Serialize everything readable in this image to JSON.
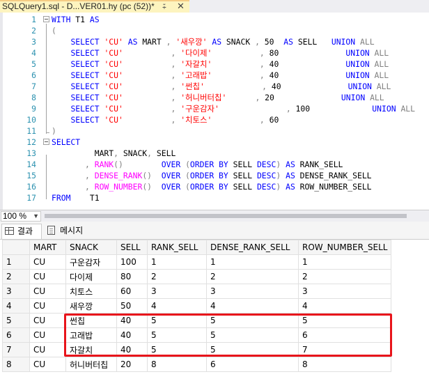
{
  "tab": {
    "title": "SQLQuery1.sql - D...VER01.hy (pc (52))*",
    "pin_icon": "pin-icon",
    "close_icon": "close-icon"
  },
  "editor": {
    "lines": [
      {
        "n": "1",
        "segs": [
          {
            "c": "kw",
            "t": "WITH"
          },
          {
            "c": "",
            "t": " T1 "
          },
          {
            "c": "kw",
            "t": "AS"
          }
        ]
      },
      {
        "n": "2",
        "segs": [
          {
            "c": "gr",
            "t": "("
          }
        ]
      },
      {
        "n": "3",
        "segs": [
          {
            "c": "",
            "t": "    "
          },
          {
            "c": "kw",
            "t": "SELECT"
          },
          {
            "c": "",
            "t": " "
          },
          {
            "c": "str",
            "t": "'CU'"
          },
          {
            "c": "",
            "t": " "
          },
          {
            "c": "kw",
            "t": "AS"
          },
          {
            "c": "",
            "t": " MART "
          },
          {
            "c": "gr",
            "t": ","
          },
          {
            "c": "",
            "t": " "
          },
          {
            "c": "str",
            "t": "'새우깡'"
          },
          {
            "c": "",
            "t": " "
          },
          {
            "c": "kw",
            "t": "AS"
          },
          {
            "c": "",
            "t": " SNACK "
          },
          {
            "c": "gr",
            "t": ","
          },
          {
            "c": "",
            "t": " 50  "
          },
          {
            "c": "kw",
            "t": "AS"
          },
          {
            "c": "",
            "t": " SELL   "
          },
          {
            "c": "kw",
            "t": "UNION"
          },
          {
            "c": "",
            "t": " "
          },
          {
            "c": "gr",
            "t": "ALL"
          }
        ]
      },
      {
        "n": "4",
        "segs": [
          {
            "c": "",
            "t": "    "
          },
          {
            "c": "kw",
            "t": "SELECT"
          },
          {
            "c": "",
            "t": " "
          },
          {
            "c": "str",
            "t": "'CU'"
          },
          {
            "c": "",
            "t": "          "
          },
          {
            "c": "gr",
            "t": ","
          },
          {
            "c": "",
            "t": " "
          },
          {
            "c": "str",
            "t": "'다이제'"
          },
          {
            "c": "",
            "t": "          "
          },
          {
            "c": "gr",
            "t": ","
          },
          {
            "c": "",
            "t": " 80              "
          },
          {
            "c": "kw",
            "t": "UNION"
          },
          {
            "c": "",
            "t": " "
          },
          {
            "c": "gr",
            "t": "ALL"
          }
        ]
      },
      {
        "n": "5",
        "segs": [
          {
            "c": "",
            "t": "    "
          },
          {
            "c": "kw",
            "t": "SELECT"
          },
          {
            "c": "",
            "t": " "
          },
          {
            "c": "str",
            "t": "'CU'"
          },
          {
            "c": "",
            "t": "          "
          },
          {
            "c": "gr",
            "t": ","
          },
          {
            "c": "",
            "t": " "
          },
          {
            "c": "str",
            "t": "'자갈치'"
          },
          {
            "c": "",
            "t": "          "
          },
          {
            "c": "gr",
            "t": ","
          },
          {
            "c": "",
            "t": " 40              "
          },
          {
            "c": "kw",
            "t": "UNION"
          },
          {
            "c": "",
            "t": " "
          },
          {
            "c": "gr",
            "t": "ALL"
          }
        ]
      },
      {
        "n": "6",
        "segs": [
          {
            "c": "",
            "t": "    "
          },
          {
            "c": "kw",
            "t": "SELECT"
          },
          {
            "c": "",
            "t": " "
          },
          {
            "c": "str",
            "t": "'CU'"
          },
          {
            "c": "",
            "t": "          "
          },
          {
            "c": "gr",
            "t": ","
          },
          {
            "c": "",
            "t": " "
          },
          {
            "c": "str",
            "t": "'고래밥'"
          },
          {
            "c": "",
            "t": "          "
          },
          {
            "c": "gr",
            "t": ","
          },
          {
            "c": "",
            "t": " 40              "
          },
          {
            "c": "kw",
            "t": "UNION"
          },
          {
            "c": "",
            "t": " "
          },
          {
            "c": "gr",
            "t": "ALL"
          }
        ]
      },
      {
        "n": "7",
        "segs": [
          {
            "c": "",
            "t": "    "
          },
          {
            "c": "kw",
            "t": "SELECT"
          },
          {
            "c": "",
            "t": " "
          },
          {
            "c": "str",
            "t": "'CU'"
          },
          {
            "c": "",
            "t": "          "
          },
          {
            "c": "gr",
            "t": ","
          },
          {
            "c": "",
            "t": " "
          },
          {
            "c": "str",
            "t": "'썬칩'"
          },
          {
            "c": "",
            "t": "            "
          },
          {
            "c": "gr",
            "t": ","
          },
          {
            "c": "",
            "t": " 40              "
          },
          {
            "c": "kw",
            "t": "UNION"
          },
          {
            "c": "",
            "t": " "
          },
          {
            "c": "gr",
            "t": "ALL"
          }
        ]
      },
      {
        "n": "8",
        "segs": [
          {
            "c": "",
            "t": "    "
          },
          {
            "c": "kw",
            "t": "SELECT"
          },
          {
            "c": "",
            "t": " "
          },
          {
            "c": "str",
            "t": "'CU'"
          },
          {
            "c": "",
            "t": "          "
          },
          {
            "c": "gr",
            "t": ","
          },
          {
            "c": "",
            "t": " "
          },
          {
            "c": "str",
            "t": "'허니버터칩'"
          },
          {
            "c": "",
            "t": "      "
          },
          {
            "c": "gr",
            "t": ","
          },
          {
            "c": "",
            "t": " 20              "
          },
          {
            "c": "kw",
            "t": "UNION"
          },
          {
            "c": "",
            "t": " "
          },
          {
            "c": "gr",
            "t": "ALL"
          }
        ]
      },
      {
        "n": "9",
        "segs": [
          {
            "c": "",
            "t": "    "
          },
          {
            "c": "kw",
            "t": "SELECT"
          },
          {
            "c": "",
            "t": " "
          },
          {
            "c": "str",
            "t": "'CU'"
          },
          {
            "c": "",
            "t": "          "
          },
          {
            "c": "gr",
            "t": ","
          },
          {
            "c": "",
            "t": " "
          },
          {
            "c": "str",
            "t": "'구운감자'"
          },
          {
            "c": "",
            "t": "              "
          },
          {
            "c": "gr",
            "t": ","
          },
          {
            "c": "",
            "t": " 100             "
          },
          {
            "c": "kw",
            "t": "UNION"
          },
          {
            "c": "",
            "t": " "
          },
          {
            "c": "gr",
            "t": "ALL"
          }
        ]
      },
      {
        "n": "10",
        "segs": [
          {
            "c": "",
            "t": "    "
          },
          {
            "c": "kw",
            "t": "SELECT"
          },
          {
            "c": "",
            "t": " "
          },
          {
            "c": "str",
            "t": "'CU'"
          },
          {
            "c": "",
            "t": "          "
          },
          {
            "c": "gr",
            "t": ","
          },
          {
            "c": "",
            "t": " "
          },
          {
            "c": "str",
            "t": "'치토스'"
          },
          {
            "c": "",
            "t": "          "
          },
          {
            "c": "gr",
            "t": ","
          },
          {
            "c": "",
            "t": " 60"
          }
        ]
      },
      {
        "n": "11",
        "segs": [
          {
            "c": "gr",
            "t": ")"
          }
        ]
      },
      {
        "n": "12",
        "segs": [
          {
            "c": "kw",
            "t": "SELECT"
          }
        ]
      },
      {
        "n": "13",
        "segs": [
          {
            "c": "",
            "t": "         MART"
          },
          {
            "c": "gr",
            "t": ","
          },
          {
            "c": "",
            "t": " SNACK"
          },
          {
            "c": "gr",
            "t": ","
          },
          {
            "c": "",
            "t": " SELL"
          }
        ]
      },
      {
        "n": "14",
        "segs": [
          {
            "c": "",
            "t": "       "
          },
          {
            "c": "gr",
            "t": ","
          },
          {
            "c": "",
            "t": " "
          },
          {
            "c": "fn",
            "t": "RANK"
          },
          {
            "c": "gr",
            "t": "()"
          },
          {
            "c": "",
            "t": "        "
          },
          {
            "c": "kw",
            "t": "OVER"
          },
          {
            "c": "",
            "t": " "
          },
          {
            "c": "gr",
            "t": "("
          },
          {
            "c": "kw",
            "t": "ORDER BY"
          },
          {
            "c": "",
            "t": " SELL "
          },
          {
            "c": "kw",
            "t": "DESC"
          },
          {
            "c": "gr",
            "t": ")"
          },
          {
            "c": "",
            "t": " "
          },
          {
            "c": "kw",
            "t": "AS"
          },
          {
            "c": "",
            "t": " RANK_SELL"
          }
        ]
      },
      {
        "n": "15",
        "segs": [
          {
            "c": "",
            "t": "       "
          },
          {
            "c": "gr",
            "t": ","
          },
          {
            "c": "",
            "t": " "
          },
          {
            "c": "fn",
            "t": "DENSE_RANK"
          },
          {
            "c": "gr",
            "t": "()"
          },
          {
            "c": "",
            "t": "  "
          },
          {
            "c": "kw",
            "t": "OVER"
          },
          {
            "c": "",
            "t": " "
          },
          {
            "c": "gr",
            "t": "("
          },
          {
            "c": "kw",
            "t": "ORDER BY"
          },
          {
            "c": "",
            "t": " SELL "
          },
          {
            "c": "kw",
            "t": "DESC"
          },
          {
            "c": "gr",
            "t": ")"
          },
          {
            "c": "",
            "t": " "
          },
          {
            "c": "kw",
            "t": "AS"
          },
          {
            "c": "",
            "t": " DENSE_RANK_SELL"
          }
        ]
      },
      {
        "n": "16",
        "segs": [
          {
            "c": "",
            "t": "       "
          },
          {
            "c": "gr",
            "t": ","
          },
          {
            "c": "",
            "t": " "
          },
          {
            "c": "fn",
            "t": "ROW_NUMBER"
          },
          {
            "c": "gr",
            "t": "()"
          },
          {
            "c": "",
            "t": "  "
          },
          {
            "c": "kw",
            "t": "OVER"
          },
          {
            "c": "",
            "t": " "
          },
          {
            "c": "gr",
            "t": "("
          },
          {
            "c": "kw",
            "t": "ORDER BY"
          },
          {
            "c": "",
            "t": " SELL "
          },
          {
            "c": "kw",
            "t": "DESC"
          },
          {
            "c": "gr",
            "t": ")"
          },
          {
            "c": "",
            "t": " "
          },
          {
            "c": "kw",
            "t": "AS"
          },
          {
            "c": "",
            "t": " ROW_NUMBER_SELL"
          }
        ]
      },
      {
        "n": "17",
        "segs": [
          {
            "c": "kw",
            "t": "FROM"
          },
          {
            "c": "",
            "t": "    T1"
          }
        ]
      }
    ]
  },
  "zoom": {
    "value": "100 %"
  },
  "result_tabs": {
    "results": "결과",
    "messages": "메시지"
  },
  "grid": {
    "columns": [
      "MART",
      "SNACK",
      "SELL",
      "RANK_SELL",
      "DENSE_RANK_SELL",
      "ROW_NUMBER_SELL"
    ],
    "rows": [
      [
        "1",
        "CU",
        "구운감자",
        "100",
        "1",
        "1",
        "1"
      ],
      [
        "2",
        "CU",
        "다이제",
        "80",
        "2",
        "2",
        "2"
      ],
      [
        "3",
        "CU",
        "치토스",
        "60",
        "3",
        "3",
        "3"
      ],
      [
        "4",
        "CU",
        "새우깡",
        "50",
        "4",
        "4",
        "4"
      ],
      [
        "5",
        "CU",
        "썬칩",
        "40",
        "5",
        "5",
        "5"
      ],
      [
        "6",
        "CU",
        "고래밥",
        "40",
        "5",
        "5",
        "6"
      ],
      [
        "7",
        "CU",
        "자갈치",
        "40",
        "5",
        "5",
        "7"
      ],
      [
        "8",
        "CU",
        "허니버터칩",
        "20",
        "8",
        "6",
        "8"
      ]
    ]
  },
  "colors": {
    "keyword": "#0000ff",
    "string": "#ff0000",
    "function": "#ff00ff",
    "operator": "#808080",
    "line_number": "#2b91af",
    "highlight": "#e8141b",
    "tab_active": "#fdf4bf"
  }
}
